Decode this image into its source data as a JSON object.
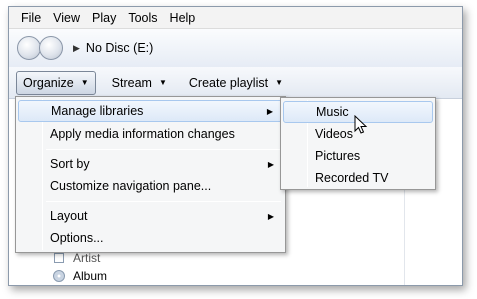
{
  "menubar": {
    "items": [
      "File",
      "View",
      "Play",
      "Tools",
      "Help"
    ]
  },
  "navbar": {
    "path": "No Disc (E:)"
  },
  "toolbar": {
    "organize": "Organize",
    "stream": "Stream",
    "create_playlist": "Create playlist"
  },
  "background": {
    "artist_label": "Artist",
    "album_label": "Album"
  },
  "organize_menu": {
    "items": [
      {
        "label": "Manage libraries",
        "has_submenu": true,
        "highlighted": true
      },
      {
        "label": "Apply media information changes"
      },
      {
        "label": "Sort by",
        "has_submenu": true
      },
      {
        "label": "Customize navigation pane..."
      },
      {
        "label": "Layout",
        "has_submenu": true
      },
      {
        "label": "Options..."
      }
    ]
  },
  "libraries_submenu": {
    "items": [
      {
        "label": "Music",
        "highlighted": true
      },
      {
        "label": "Videos"
      },
      {
        "label": "Pictures"
      },
      {
        "label": "Recorded TV"
      }
    ]
  },
  "icons": {
    "back": "back-arrow-icon",
    "forward": "forward-arrow-icon",
    "path_arrow": "breadcrumb-arrow-icon",
    "dropdown": "chevron-down-icon",
    "submenu": "chevron-right-icon",
    "album": "album-icon",
    "cursor": "mouse-pointer-icon"
  },
  "colors": {
    "highlight_border": "#a8c8ee",
    "highlight_fill": "#dde9f8",
    "menu_bg": "#f5f6f7"
  }
}
